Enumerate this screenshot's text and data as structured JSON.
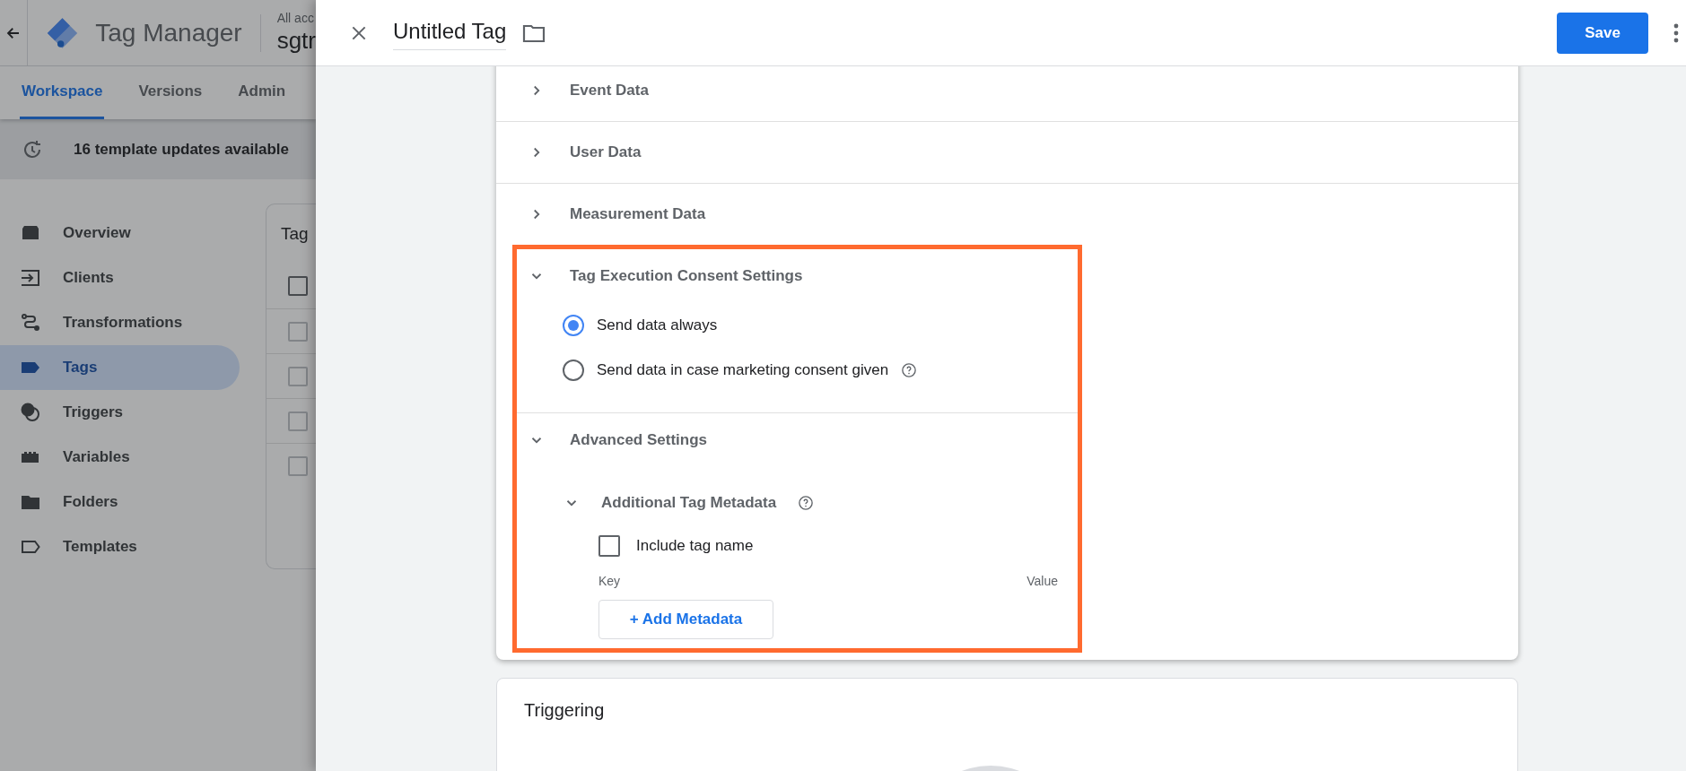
{
  "background_app": {
    "title": "Tag Manager",
    "account_label": "All acc",
    "container_name": "sgtr",
    "tabs": [
      {
        "label": "Workspace",
        "selected": true
      },
      {
        "label": "Versions",
        "selected": false
      },
      {
        "label": "Admin",
        "selected": false
      }
    ],
    "notice": "16 template updates available",
    "nav": [
      {
        "label": "Overview",
        "kind": "overview",
        "selected": false
      },
      {
        "label": "Clients",
        "kind": "clients",
        "selected": false
      },
      {
        "label": "Transformations",
        "kind": "transformations",
        "selected": false
      },
      {
        "label": "Tags",
        "kind": "tags",
        "selected": true
      },
      {
        "label": "Triggers",
        "kind": "triggers",
        "selected": false
      },
      {
        "label": "Variables",
        "kind": "variables",
        "selected": false
      },
      {
        "label": "Folders",
        "kind": "folders",
        "selected": false
      },
      {
        "label": "Templates",
        "kind": "templates",
        "selected": false
      }
    ],
    "table": {
      "title": "Tag",
      "header_checked": false,
      "rows": [
        {
          "checked": false
        },
        {
          "checked": false
        },
        {
          "checked": false
        },
        {
          "checked": false
        }
      ]
    }
  },
  "panel": {
    "title": "Untitled Tag",
    "save": "Save",
    "sections": [
      {
        "title": "Event Data",
        "kind": "collapsed",
        "expanded": false,
        "highlighted": false
      },
      {
        "title": "User Data",
        "kind": "collapsed",
        "expanded": false,
        "highlighted": false
      },
      {
        "title": "Measurement Data",
        "kind": "collapsed",
        "expanded": false,
        "highlighted": false
      },
      {
        "title": "Tag Execution Consent Settings",
        "kind": "radio",
        "expanded": true,
        "highlighted": true,
        "options": [
          {
            "label": "Send data always",
            "selected": true,
            "help": false
          },
          {
            "label": "Send data in case marketing consent given",
            "selected": false,
            "help": true
          }
        ]
      },
      {
        "title": "Advanced Settings",
        "kind": "advanced",
        "expanded": true,
        "highlighted": true,
        "subsection": {
          "title": "Additional Tag Metadata",
          "expanded": true,
          "checkbox": {
            "label": "Include tag name",
            "checked": false
          },
          "columns": [
            "Key",
            "Value"
          ],
          "button": "+ Add Metadata"
        }
      }
    ],
    "triggering": {
      "title": "Triggering"
    }
  }
}
